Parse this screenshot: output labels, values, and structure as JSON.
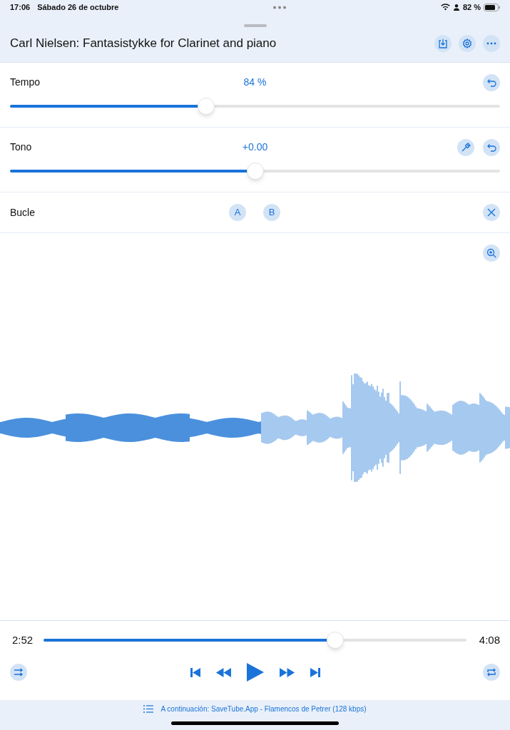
{
  "status_bar": {
    "time": "17:06",
    "date": "Sábado 26 de octubre",
    "battery": "82 %"
  },
  "header": {
    "title": "Carl Nielsen: Fantasistykke for Clarinet and piano"
  },
  "controls": [
    {
      "kind": "slider",
      "label": "Tempo",
      "reading": "84 %",
      "level": 0.4,
      "tuner": false
    },
    {
      "kind": "slider",
      "label": "Tono",
      "reading": "+0.00",
      "level": 0.5,
      "tuner": true
    }
  ],
  "loop": {
    "label": "Bucle",
    "point_a": "A",
    "point_b": "B"
  },
  "player": {
    "elapsed": "2:52",
    "total": "4:08",
    "level": 0.69
  },
  "footer": {
    "up_next": "A continuación: SaveTube.App - Flamencos de Petrer (128 kbps)"
  }
}
